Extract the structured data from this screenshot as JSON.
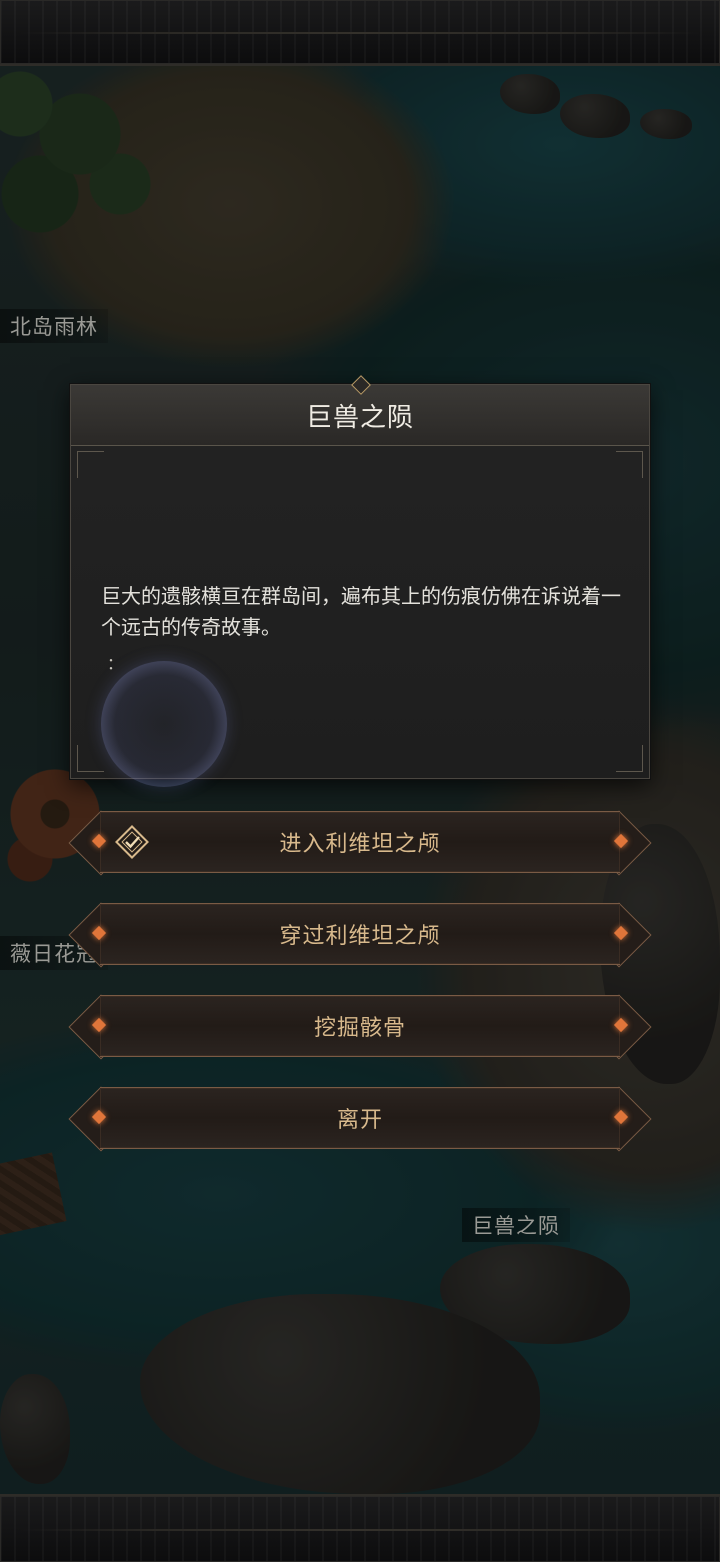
{
  "map": {
    "labels": {
      "north_rainforest": "北岛雨林",
      "flower": "薇日花冠",
      "beast_fall": "巨兽之陨"
    }
  },
  "dialog": {
    "title": "巨兽之陨",
    "description": "巨大的遗骸横亘在群岛间，遍布其上的伤痕仿佛在诉说着一个远古的传奇故事。",
    "dot": "："
  },
  "options": [
    {
      "label": "进入利维坦之颅",
      "selected": true
    },
    {
      "label": "穿过利维坦之颅"
    },
    {
      "label": "挖掘骸骨"
    },
    {
      "label": "离开"
    }
  ],
  "colors": {
    "option_text": "#d8b98c",
    "option_gem": "#e0753a",
    "title_text": "#f0ece4"
  },
  "icons": {
    "selected_option": "check-diamond-icon"
  }
}
